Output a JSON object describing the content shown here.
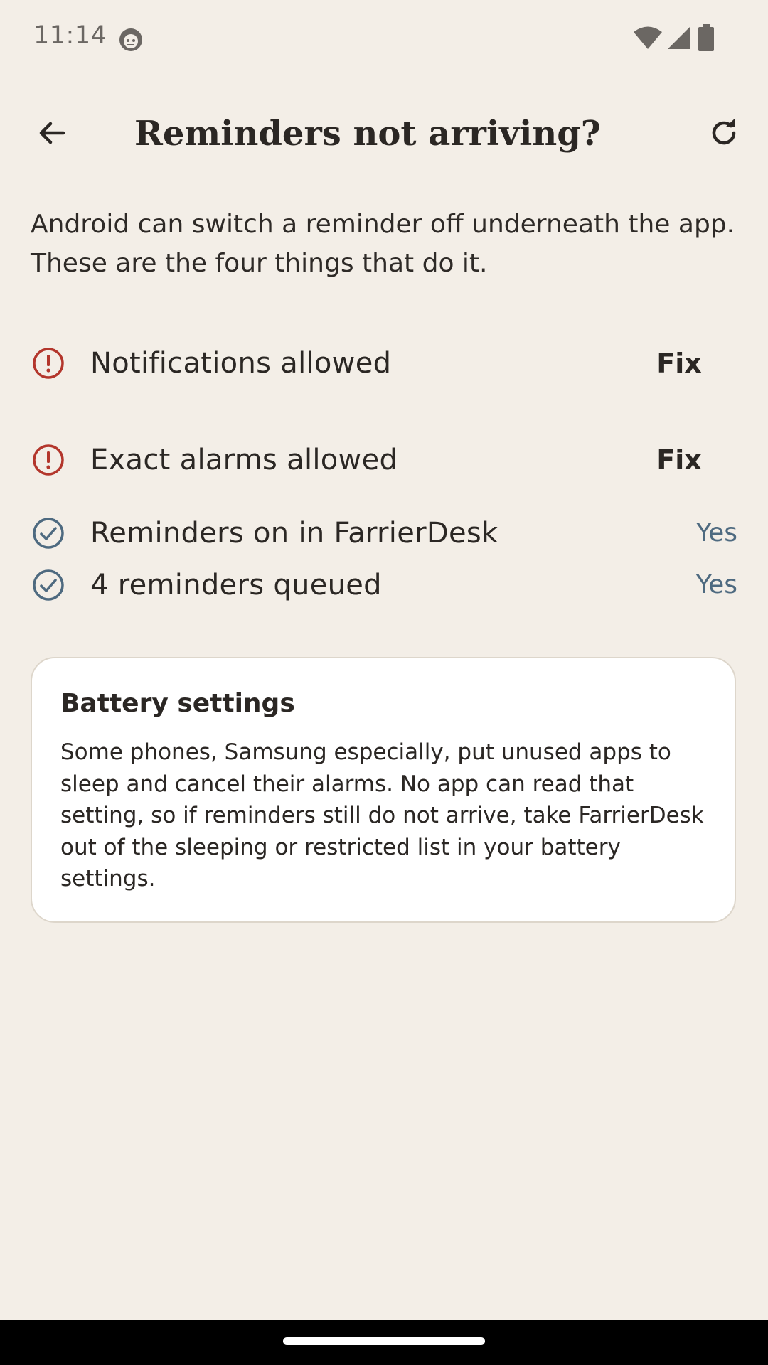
{
  "status_bar": {
    "time": "11:14",
    "icons": [
      "face-icon",
      "wifi-icon",
      "signal-icon",
      "battery-icon"
    ]
  },
  "app_bar": {
    "title": "Reminders not arriving?",
    "back_icon": "arrow-left-icon",
    "refresh_icon": "refresh-icon"
  },
  "intro": "Android can switch a reminder off underneath the app. These are the four things that do it.",
  "checks": [
    {
      "label": "Notifications allowed",
      "ok": false,
      "icon": "alert-circle-icon",
      "action": "Fix"
    },
    {
      "label": "Exact alarms allowed",
      "ok": false,
      "icon": "alert-circle-icon",
      "action": "Fix"
    },
    {
      "label": "Reminders on in FarrierDesk",
      "ok": true,
      "icon": "check-circle-icon",
      "status": "Yes"
    },
    {
      "label": "4 reminders queued",
      "ok": true,
      "icon": "check-circle-icon",
      "status": "Yes"
    }
  ],
  "battery_card": {
    "title": "Battery settings",
    "body": "Some phones, Samsung especially, put unused apps to sleep and cancel their alarms. No app can read that setting, so if reminders still do not arrive, take FarrierDesk out of the sleeping or restricted list in your battery settings."
  },
  "colors": {
    "background": "#F3EEE7",
    "alert": "#B3362C",
    "ok": "#4E6A80",
    "text": "#2B2724"
  }
}
